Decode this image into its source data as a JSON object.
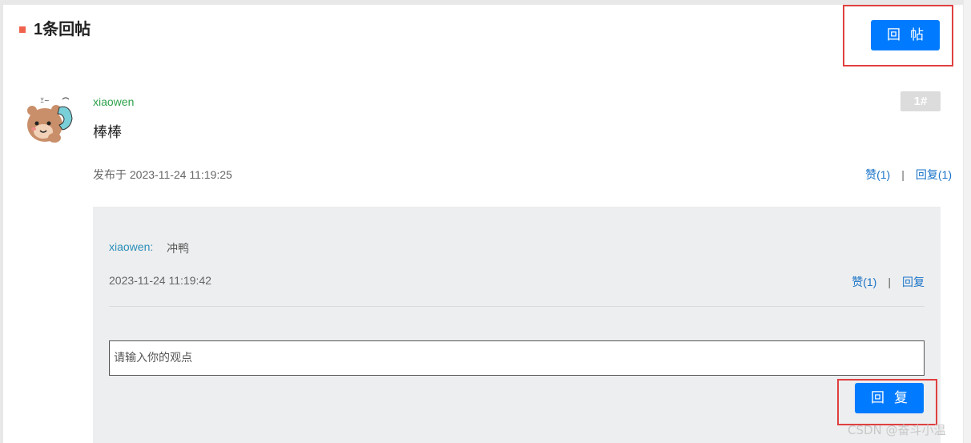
{
  "header": {
    "title": "1条回帖",
    "post_button": "回帖"
  },
  "post": {
    "username": "xiaowen",
    "floor": "1#",
    "content": "棒棒",
    "time": "发布于 2023-11-24 11:19:25",
    "like_label": "赞(1)",
    "separator": "|",
    "reply_label": "回复(1)"
  },
  "replies": [
    {
      "username": "xiaowen:",
      "text": "冲鸭",
      "time": "2023-11-24 11:19:42",
      "like_label": "赞(1)",
      "separator": "|",
      "reply_label": "回复"
    }
  ],
  "reply_box": {
    "placeholder": "请输入你的观点",
    "submit_label": "回复"
  },
  "watermark": "CSDN @奋斗小温",
  "colors": {
    "accent": "#007bff",
    "marker": "#f0624d",
    "username": "#2ea14a",
    "reply_username": "#2a8fb8",
    "link": "#1a73c8",
    "highlight": "#e04040"
  },
  "icons": {
    "avatar": "bear-avatar-icon"
  }
}
